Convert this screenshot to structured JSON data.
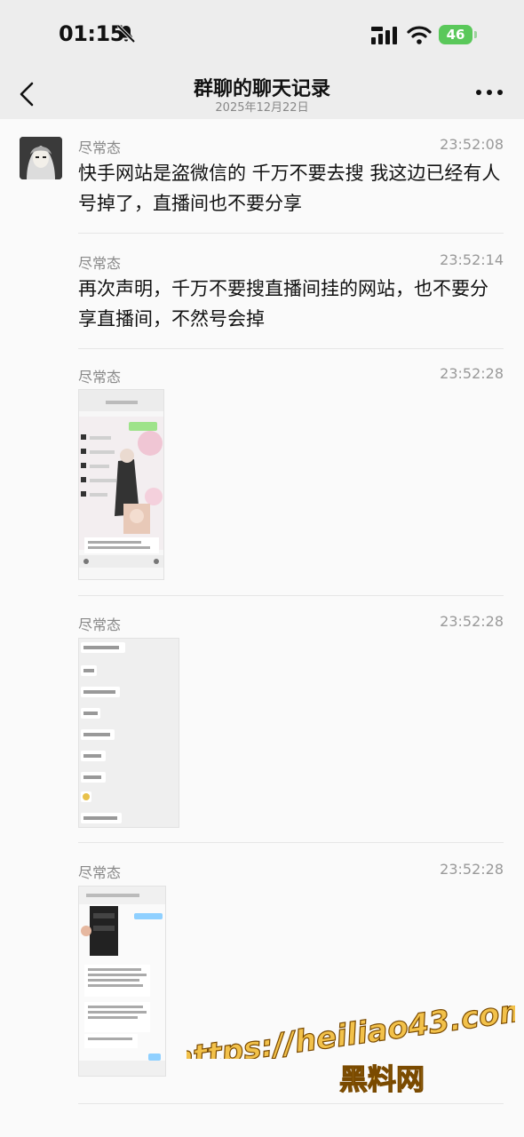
{
  "status_bar": {
    "time": "01:15",
    "battery": "46"
  },
  "nav": {
    "title": "群聊的聊天记录",
    "subtitle": "2025年12月22日"
  },
  "messages": [
    {
      "sender": "尽常态",
      "time": "23:52:08",
      "text": "快手网站是盗微信的 千万不要去搜 我这边已经有人号掉了，直播间也不要分享"
    },
    {
      "sender": "尽常态",
      "time": "23:52:14",
      "text": "再次声明，千万不要搜直播间挂的网站，也不要分享直播间，不然号会掉"
    },
    {
      "sender": "尽常态",
      "time": "23:52:28"
    },
    {
      "sender": "尽常态",
      "time": "23:52:28"
    },
    {
      "sender": "尽常态",
      "time": "23:52:28"
    }
  ],
  "watermark": {
    "url": "https://heiliao43.com",
    "name": "黑料网"
  },
  "colors": {
    "header_bg": "#ededed",
    "battery": "#5ac85a",
    "watermark": "#f2c14a"
  },
  "icons": [
    "back-arrow-icon",
    "more-icon",
    "bell-muted-icon",
    "signal-icon",
    "wifi-icon"
  ]
}
